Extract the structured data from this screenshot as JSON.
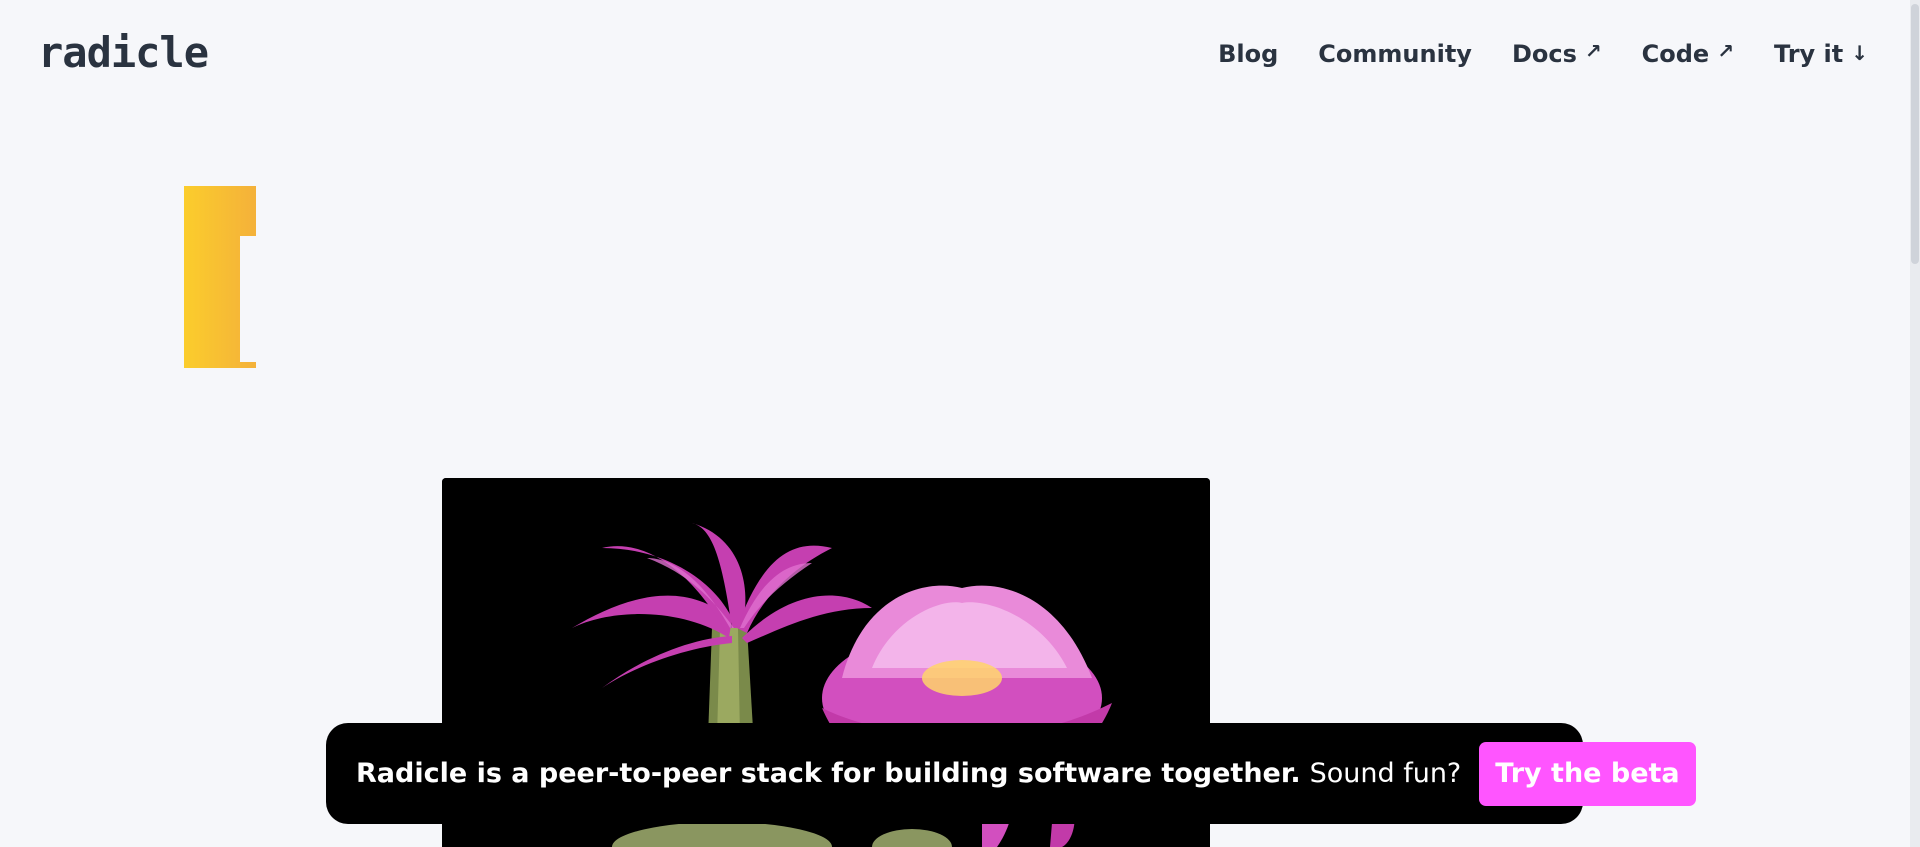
{
  "header": {
    "logo": "radicle",
    "nav": [
      {
        "label": "Blog",
        "icon": ""
      },
      {
        "label": "Community",
        "icon": ""
      },
      {
        "label": "Docs",
        "icon": "↗"
      },
      {
        "label": "Code",
        "icon": "↗"
      },
      {
        "label": "Try it",
        "icon": "↓"
      }
    ]
  },
  "banner": {
    "strong_text": "Radicle is a peer-to-peer stack for building software together.",
    "light_text": "Sound fun?",
    "cta_label": "Try the beta"
  },
  "colors": {
    "background": "#f6f7fa",
    "text": "#2a3340",
    "accent_pink": "#ff55ff",
    "bracket_yellow": "#f9c72a"
  }
}
